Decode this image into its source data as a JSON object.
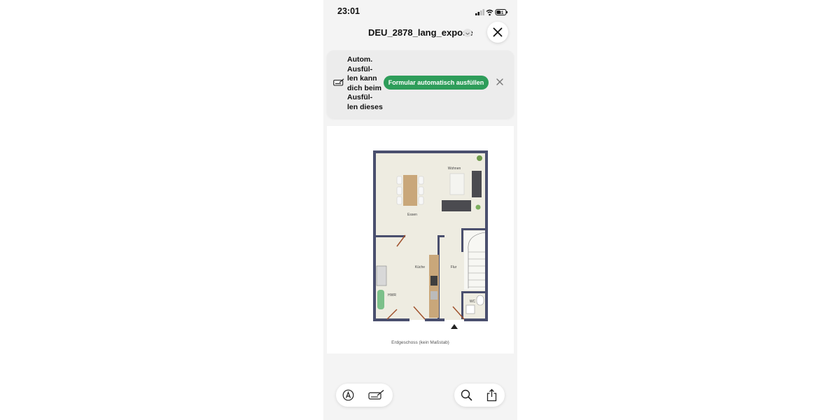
{
  "status": {
    "time": "23:01",
    "battery": "31"
  },
  "header": {
    "title": "DEU_2878_lang_expose"
  },
  "autofill": {
    "message_lines": [
      "Autom.",
      "Ausfül-",
      "len kann",
      "dich beim",
      "Ausfül-",
      "len dieses"
    ],
    "button_label": "Formular automatisch ausfüllen"
  },
  "floorplan": {
    "rooms": {
      "wohnen": "Wohnen",
      "essen": "Essen",
      "kueche": "Küche",
      "flur": "Flur",
      "hwr": "HWR",
      "wc": "WC"
    },
    "caption": "Erdgeschoss (kein Maßstab)"
  },
  "icons": {
    "markup": "markup-icon",
    "autofill": "autofill-signature-icon",
    "search": "search-icon",
    "share": "share-icon",
    "close": "close-icon"
  },
  "colors": {
    "accent_green": "#2e9d5a",
    "wall": "#4a4f6e",
    "floor": "#eeece1"
  }
}
